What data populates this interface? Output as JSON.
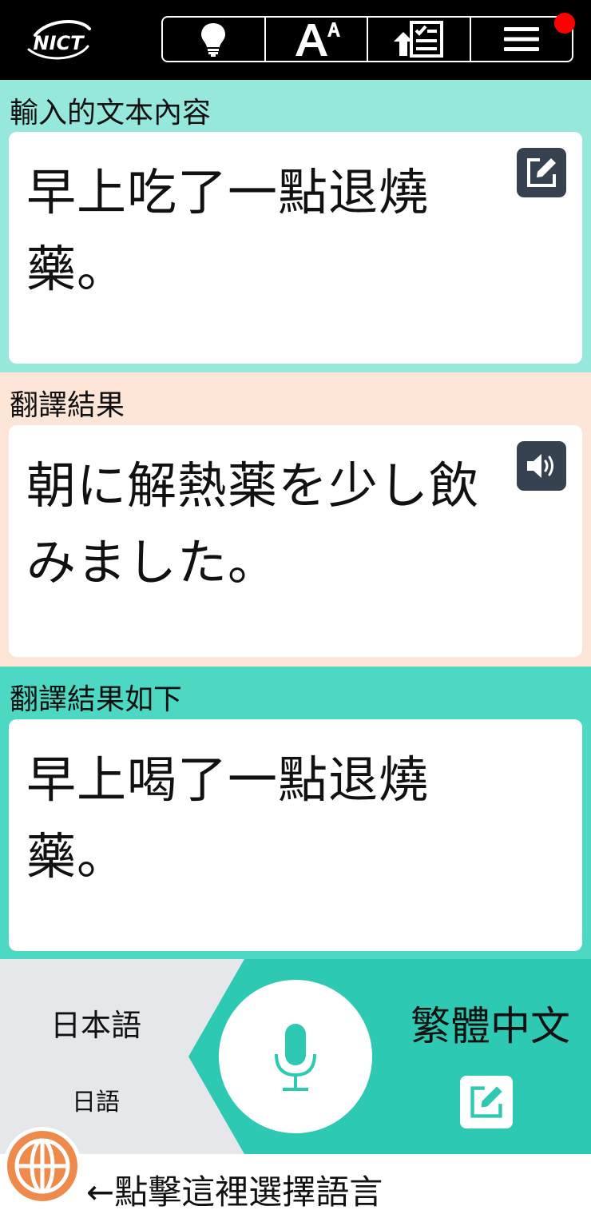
{
  "header": {
    "logo_text": "NICT",
    "toolbar": [
      {
        "name": "tips",
        "icon": "lightbulb-icon"
      },
      {
        "name": "font-size",
        "icon": "font-size-icon"
      },
      {
        "name": "upload",
        "icon": "upload-checklist-icon"
      },
      {
        "name": "menu",
        "icon": "hamburger-menu-icon"
      }
    ],
    "notification_color": "#ff0000"
  },
  "input_panel": {
    "label": "輸入的文本內容",
    "text": "早上吃了一點退燒藥。",
    "action_icon": "edit-icon",
    "color": "#96e8dc"
  },
  "translation_panel": {
    "label": "翻譯結果",
    "text": "朝に解熱薬を少し飲みました。",
    "action_icon": "speaker-icon",
    "color": "#fde5d8"
  },
  "back_translation_panel": {
    "label": "翻譯結果如下",
    "text": "早上喝了一點退燒藥。",
    "color": "#4dd8c4"
  },
  "language_bar": {
    "source_language": "日本語",
    "source_language_native": "日語",
    "target_language": "繁體中文",
    "mic_icon": "microphone-icon",
    "target_edit_icon": "edit-icon",
    "accent_color": "#2ec9b2"
  },
  "footer": {
    "hint": "←點擊這裡選擇語言",
    "globe_icon": "globe-icon",
    "globe_color": "#ee8a4c"
  }
}
